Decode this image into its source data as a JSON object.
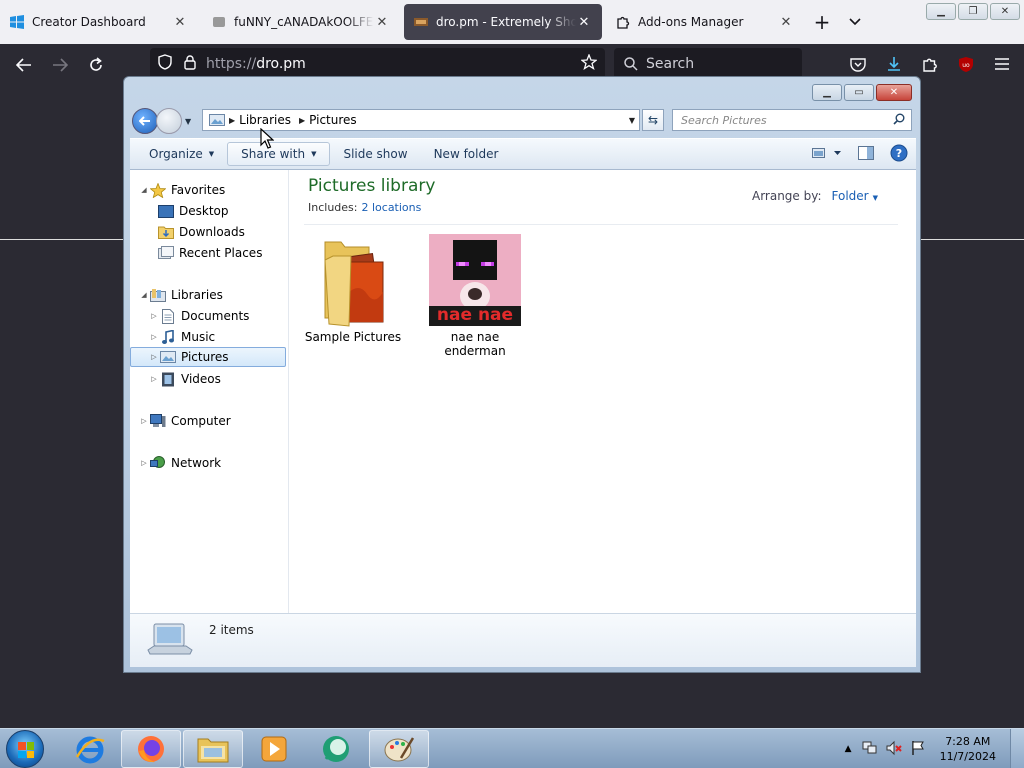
{
  "browser": {
    "tabs": [
      {
        "title": "Creator Dashboard",
        "active": false
      },
      {
        "title": "fuNNY_cANADAkOOLFEVER",
        "active": false
      },
      {
        "title": "dro.pm - Extremely Short Links",
        "active": true
      },
      {
        "title": "Add-ons Manager",
        "active": false
      }
    ],
    "url_protocol": "https://",
    "url_host": "dro.pm",
    "search_placeholder": "Search"
  },
  "explorer": {
    "breadcrumb": [
      "Libraries",
      "Pictures"
    ],
    "search_placeholder": "Search Pictures",
    "commands": [
      "Organize",
      "Share with",
      "Slide show",
      "New folder"
    ],
    "nav": {
      "favorites": "Favorites",
      "favorites_items": [
        "Desktop",
        "Downloads",
        "Recent Places"
      ],
      "libraries": "Libraries",
      "libraries_items": [
        "Documents",
        "Music",
        "Pictures",
        "Videos"
      ],
      "computer": "Computer",
      "network": "Network"
    },
    "library_title": "Pictures library",
    "includes_label": "Includes:",
    "includes_link": "2 locations",
    "arrange_label": "Arrange by:",
    "arrange_value": "Folder",
    "items": [
      {
        "name": "Sample Pictures",
        "type": "folder"
      },
      {
        "name": "nae nae enderman",
        "type": "image",
        "caption_in_image": "nae nae"
      }
    ],
    "details": "2 items"
  },
  "taskbar": {
    "time": "7:28 AM",
    "date": "11/7/2024"
  },
  "colors": {
    "firefox_dark": "#2b2a33",
    "library_title": "#1e6b28",
    "link": "#1a5fb4"
  }
}
